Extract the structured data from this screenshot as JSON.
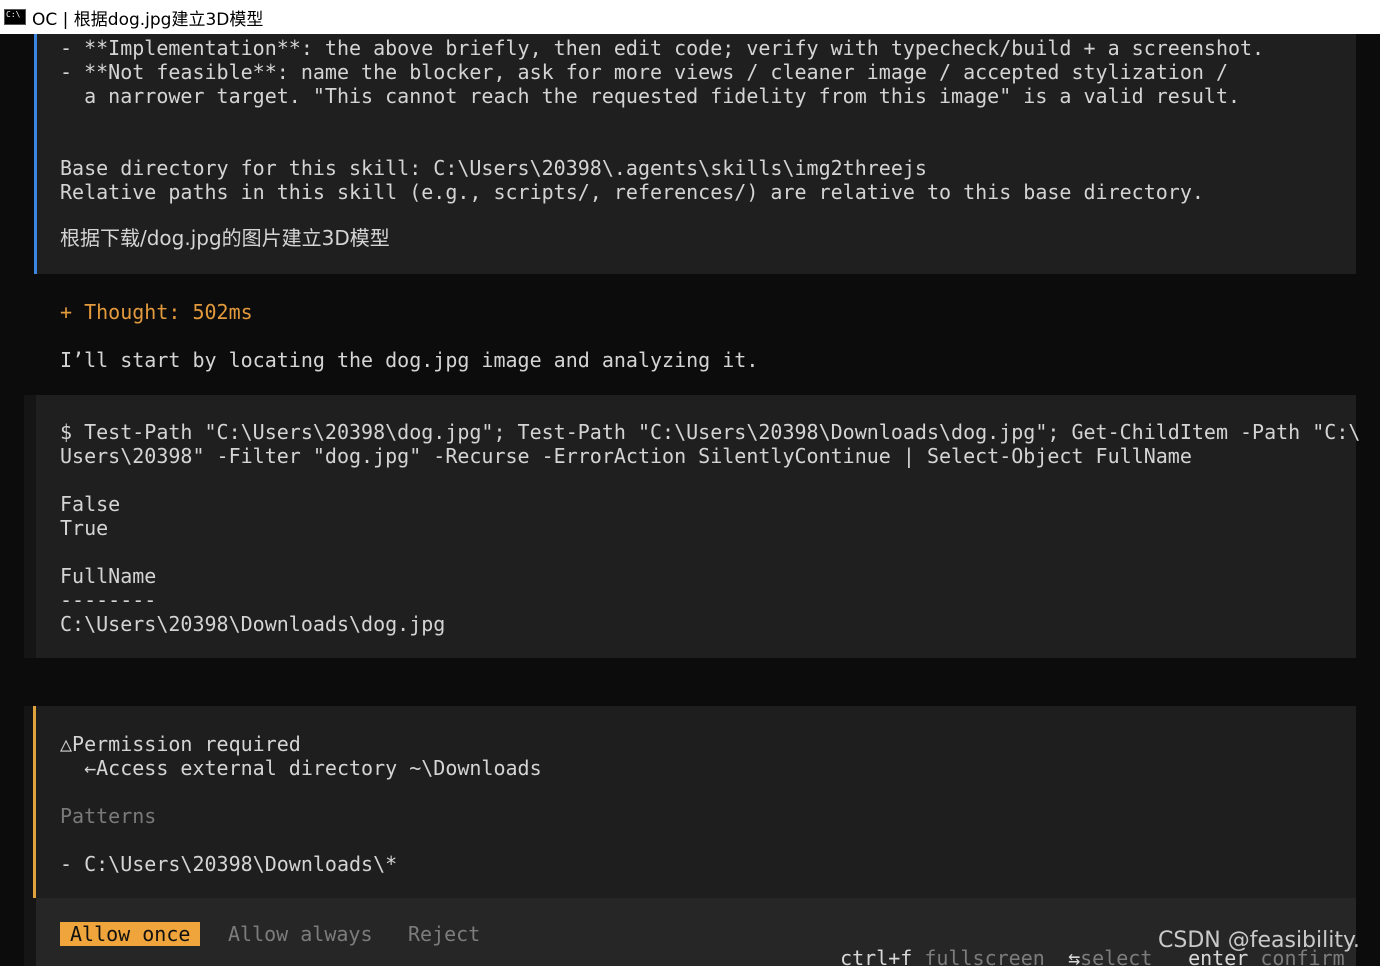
{
  "window": {
    "title": "OC | 根据dog.jpg建立3D模型",
    "icon": "console-icon"
  },
  "skill_block": {
    "lines": [
      "- **Implementation**: the above briefly, then edit code; verify with typecheck/build + a screenshot.",
      "- **Not feasible**: name the blocker, ask for more views / cleaner image / accepted stylization /",
      "  a narrower target. \"This cannot reach the requested fidelity from this image\" is a valid result."
    ],
    "base_dir": "Base directory for this skill: C:\\Users\\20398\\.agents\\skills\\img2threejs",
    "relative_paths": "Relative paths in this skill (e.g., scripts/, references/) are relative to this base directory.",
    "user_prompt": "根据下载/dog.jpg的图片建立3D模型"
  },
  "assistant": {
    "thought": "+ Thought: 502ms",
    "message": "I’ll start by locating the dog.jpg image and analyzing it."
  },
  "command_block": {
    "command_line1": "$ Test-Path \"C:\\Users\\20398\\dog.jpg\"; Test-Path \"C:\\Users\\20398\\Downloads\\dog.jpg\"; Get-ChildItem -Path \"C:\\",
    "command_line2": "Users\\20398\" -Filter \"dog.jpg\" -Recurse -ErrorAction SilentlyContinue | Select-Object FullName",
    "output": [
      "False",
      "True",
      "",
      "FullName",
      "--------",
      "C:\\Users\\20398\\Downloads\\dog.jpg"
    ]
  },
  "permission": {
    "heading": "△Permission required",
    "detail": "  ←Access external directory ~\\Downloads",
    "patterns_label": "Patterns",
    "pattern": "- C:\\Users\\20398\\Downloads\\*"
  },
  "actions": {
    "allow_once": "Allow once",
    "allow_always": "Allow always",
    "reject": "Reject",
    "hint_fullscreen_key": "ctrl+f",
    "hint_fullscreen": "fullscreen",
    "hint_select_key": "⇆",
    "hint_select": "select",
    "hint_confirm_key": "enter",
    "hint_confirm": "confirm"
  },
  "watermark": "CSDN @feasibility.",
  "colors": {
    "accent_blue": "#3a86e0",
    "accent_amber": "#e39a3c",
    "panel": "#1f1f1f",
    "background": "#0c0c0c"
  }
}
